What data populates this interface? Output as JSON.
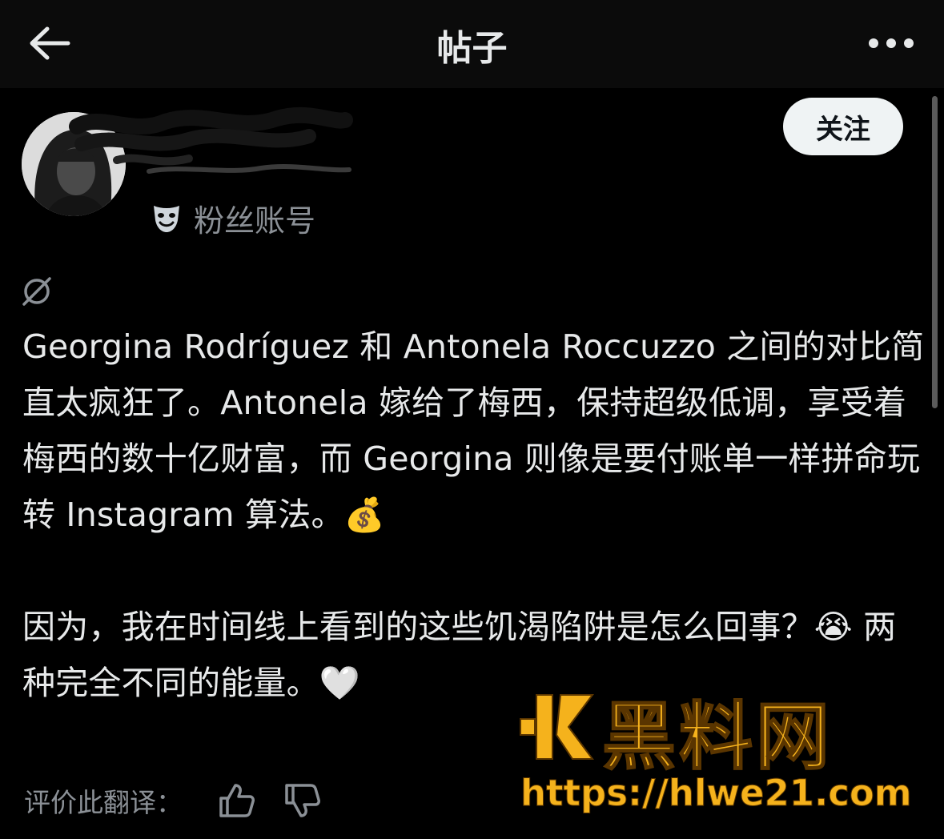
{
  "header": {
    "title": "帖子",
    "back_icon": "arrow-left-icon",
    "more_icon": "more-horizontal-icon"
  },
  "author": {
    "badge_icon": "theater-mask-icon",
    "badge_label": "粉丝账号",
    "follow_label": "关注"
  },
  "post": {
    "visibility_icon": "globe-off-icon",
    "paragraph1": "Georgina Rodríguez 和 Antonela Roccuzzo 之间的对比简直太疯狂了。Antonela 嫁给了梅西，保持超级低调，享受着梅西的数十亿财富，而 Georgina 则像是要付账单一样拼命玩转 Instagram 算法。💰",
    "paragraph2": "因为，我在时间线上看到的这些饥渴陷阱是怎么回事？😭 两种完全不同的能量。🤍"
  },
  "translate": {
    "label": "评价此翻译：",
    "like_icon": "thumbs-up-icon",
    "dislike_icon": "thumbs-down-icon"
  },
  "watermark": {
    "brand": "黑料网",
    "url": "https://hlwe21.com",
    "brand_color": "#f5b21c"
  }
}
